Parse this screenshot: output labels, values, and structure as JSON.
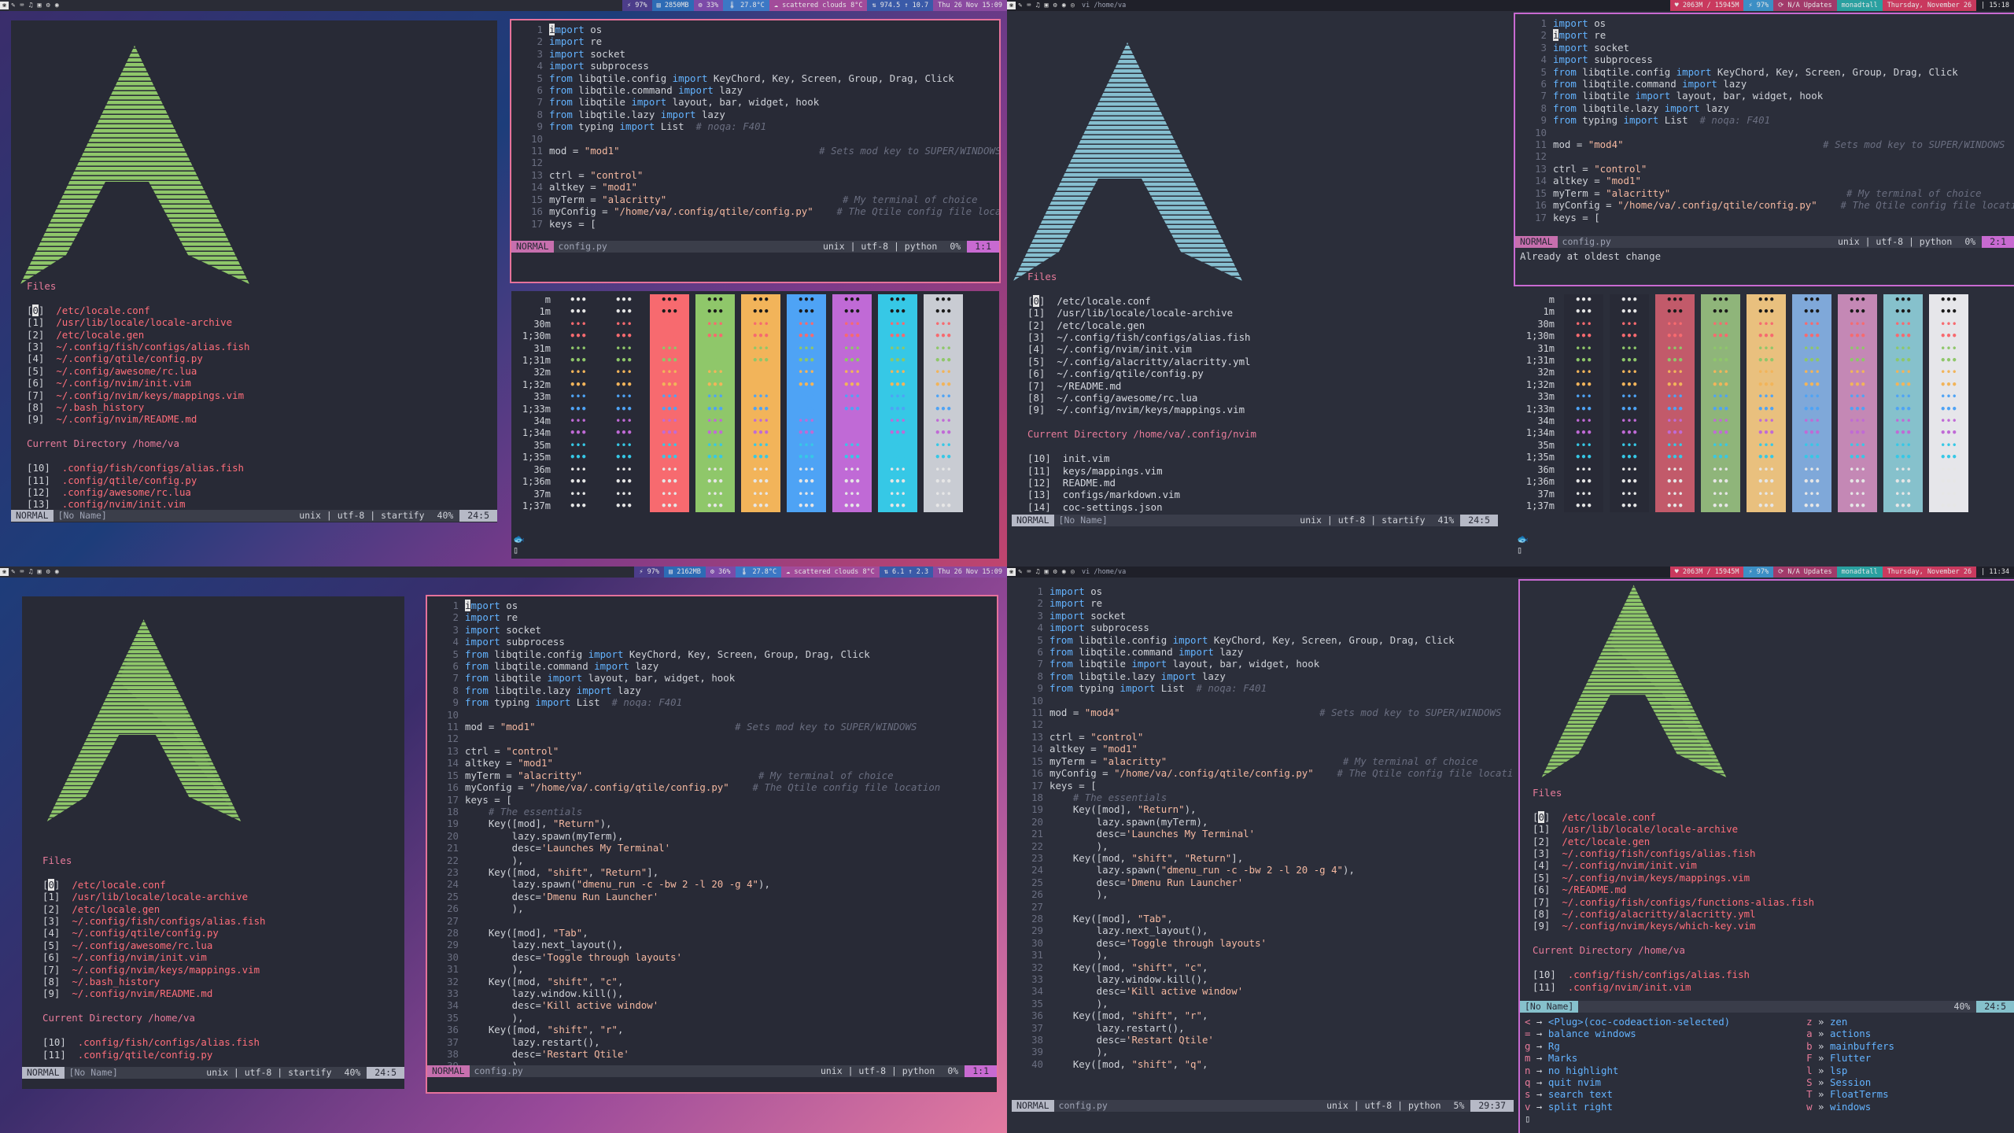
{
  "bars": {
    "tl": {
      "weather": "8°C",
      "clouds": "scattered clouds",
      "mem": "2850MB",
      "cpu": "33%",
      "temp": "27.8°C",
      "net": "974.5 ↑ 10.7",
      "date": "Thu 26 Nov 15:09",
      "prompt": "97%"
    },
    "tr": {
      "title": "vi /home/va",
      "mem": "2063M / 15945M",
      "cpu": "97%",
      "updates": "N/A Updates",
      "user": "monadtall",
      "date": "Thursday, November 26",
      "time": "15:18"
    },
    "bl": {
      "weather": "8°C",
      "clouds": "scattered clouds",
      "mem": "2162MB",
      "cpu": "36%",
      "temp": "27.8°C",
      "net": "6.1 ↑ 2.3",
      "date": "Thu 26 Nov 15:09",
      "prompt": "97%"
    },
    "br": {
      "title": "vi /home/va",
      "mem": "2063M / 15945M",
      "cpu": "97%",
      "updates": "N/A Updates",
      "user": "monadtall",
      "date": "Thursday, November 26",
      "time": "11:34"
    }
  },
  "startify": {
    "files_header": "Files",
    "current_dir_header": "Current Directory /home/va",
    "current_dir_header_nvim": "Current Directory /home/va/.config/nvim",
    "tl_files": [
      "/etc/locale.conf",
      "/usr/lib/locale/locale-archive",
      "/etc/locale.gen",
      "~/.config/fish/configs/alias.fish",
      "~/.config/qtile/config.py",
      "~/.config/awesome/rc.lua",
      "~/.config/nvim/init.vim",
      "~/.config/nvim/keys/mappings.vim",
      "~/.bash_history",
      "~/.config/nvim/README.md"
    ],
    "tl_dirs": [
      ".config/fish/configs/alias.fish",
      ".config/qtile/config.py",
      ".config/awesome/rc.lua",
      ".config/nvim/init.vim"
    ],
    "tr_files": [
      "/etc/locale.conf",
      "/usr/lib/locale/locale-archive",
      "/etc/locale.gen",
      "~/.config/fish/configs/alias.fish",
      "~/.config/nvim/init.vim",
      "~/.config/alacritty/alacritty.yml",
      "~/.config/qtile/config.py",
      "~/README.md",
      "~/.config/awesome/rc.lua",
      "~/.config/nvim/keys/mappings.vim"
    ],
    "tr_dirs": [
      "init.vim",
      "keys/mappings.vim",
      "README.md",
      "configs/markdown.vim",
      "coc-settings.json"
    ],
    "br_files": [
      "/etc/locale.conf",
      "/usr/lib/locale/locale-archive",
      "/etc/locale.gen",
      "~/.config/fish/configs/alias.fish",
      "~/.config/nvim/init.vim",
      "~/.config/nvim/keys/mappings.vim",
      "~/README.md",
      "~/.config/fish/configs/functions-alias.fish",
      "~/.config/alacritty/alacritty.yml",
      "~/.config/nvim/keys/which-key.vim"
    ],
    "br_dirs": [
      ".config/fish/configs/alias.fish",
      ".config/nvim/init.vim"
    ]
  },
  "status": {
    "normal": "NORMAL",
    "noname": "[No Name]",
    "noname_br": "[No Name]",
    "startify_info": "unix | utf-8 | startify",
    "python_info": "unix | utf-8 | python",
    "configpy": "config.py",
    "pct_40": "40%",
    "pct_41": "41%",
    "pct_0": "0%",
    "pct_5": "5%",
    "pos_245": "24:5",
    "pos_11": "1:1",
    "pos_21": "2:1",
    "pos_2937": "29:37",
    "pos_br": "24:5",
    "msg": "Already at oldest change"
  },
  "whichkey": [
    {
      "k": "<",
      "a": "<Plug>(coc-codeaction-selected)",
      "k2": "z",
      "a2": "zen"
    },
    {
      "k": "=",
      "a": "balance windows",
      "k2": "a",
      "a2": "actions"
    },
    {
      "k": "g",
      "a": "Rg",
      "k2": "b",
      "a2": "mainbuffers"
    },
    {
      "k": "m",
      "a": "Marks",
      "k2": "F",
      "a2": "Flutter"
    },
    {
      "k": "n",
      "a": "no highlight",
      "k2": "l",
      "a2": "lsp"
    },
    {
      "k": "q",
      "a": "quit nvim",
      "k2": "S",
      "a2": "Session"
    },
    {
      "k": "s",
      "a": "search text",
      "k2": "T",
      "a2": "FloatTerms"
    },
    {
      "k": "v",
      "a": "split right",
      "k2": "w",
      "a2": "windows"
    }
  ],
  "colors_labels": [
    "m",
    "1m",
    "30m",
    "1;30m",
    "31m",
    "1;31m",
    "32m",
    "1;32m",
    "33m",
    "1;33m",
    "34m",
    "1;34m",
    "35m",
    "1;35m",
    "36m",
    "1;36m",
    "37m",
    "1;37m"
  ],
  "colors_bg": [
    "#282a36",
    "#282a36",
    "#f76a6f",
    "#8fc76a",
    "#f2b45a",
    "#4ea3f5",
    "#c06ad6",
    "#36c8e6",
    "#c9ccd3"
  ],
  "colors_bg_tr": [
    "#282a36",
    "#282a36",
    "#c25a6a",
    "#8fb57a",
    "#e9c07e",
    "#7fa8d9",
    "#c488b5",
    "#86c1cc",
    "#e6e6ea"
  ],
  "colors_dot": "•••",
  "code": [
    [
      "kw:import",
      " os"
    ],
    [
      "kw:import",
      " re"
    ],
    [
      "kw:import",
      " socket"
    ],
    [
      "kw:import",
      " subprocess"
    ],
    [
      "kw:from",
      " libqtile.config ",
      "kw:import",
      " KeyChord, Key, Screen, Group, Drag, Click"
    ],
    [
      "kw:from",
      " libqtile.command ",
      "kw:import",
      " lazy"
    ],
    [
      "kw:from",
      " libqtile ",
      "kw:import",
      " layout, bar, widget, hook"
    ],
    [
      "kw:from",
      " libqtile.lazy ",
      "kw:import",
      " lazy"
    ],
    [
      "kw:from",
      " typing ",
      "kw:import",
      " List  ",
      "cm:# noqa: F401"
    ],
    [
      ""
    ],
    [
      "mod = ",
      "str:\"mod4\"",
      "                                  ",
      "cm:# Sets mod key to SUPER/WINDOWS"
    ],
    [
      ""
    ],
    [
      "ctrl = ",
      "str:\"control\""
    ],
    [
      "altkey = ",
      "str:\"mod1\""
    ],
    [
      "myTerm = ",
      "str:\"alacritty\"",
      "                              ",
      "cm:# My terminal of choice"
    ],
    [
      "myConfig = ",
      "str:\"/home/va/.config/qtile/config.py\"",
      "    ",
      "cm:# The Qtile config file location"
    ],
    [
      "keys = ["
    ],
    [
      "    ",
      "cm:# The essentials"
    ],
    [
      "    Key([mod], ",
      "str:\"Return\"",
      "),"
    ],
    [
      "        lazy.spawn(myTerm),"
    ],
    [
      "        desc=",
      "str:'Launches My Terminal'"
    ],
    [
      "        ),"
    ],
    [
      "    Key([mod, ",
      "str:\"shift\"",
      ", ",
      "str:\"Return\"",
      "],"
    ],
    [
      "        lazy.spawn(",
      "str:\"dmenu_run -c -bw 2 -l 20 -g 4\"",
      "),"
    ],
    [
      "        desc=",
      "str:'Dmenu Run Launcher'"
    ],
    [
      "        ),"
    ],
    [
      ""
    ],
    [
      "    Key([mod], ",
      "str:\"Tab\"",
      ","
    ],
    [
      "        lazy.next_layout(),"
    ],
    [
      "        desc=",
      "str:'Toggle through layouts'"
    ],
    [
      "        ),"
    ],
    [
      "    Key([mod, ",
      "str:\"shift\"",
      ", ",
      "str:\"c\"",
      ","
    ],
    [
      "        lazy.window.kill(),"
    ],
    [
      "        desc=",
      "str:'Kill active window'"
    ],
    [
      "        ),"
    ],
    [
      "    Key([mod, ",
      "str:\"shift\"",
      ", ",
      "str:\"r\"",
      ","
    ],
    [
      "        lazy.restart(),"
    ],
    [
      "        desc=",
      "str:'Restart Qtile'"
    ],
    [
      "        ),"
    ],
    [
      "    Key([mod, ",
      "str:\"shift\"",
      ", ",
      "str:\"q\"",
      ","
    ]
  ],
  "code_mod1": "\"mod1\""
}
